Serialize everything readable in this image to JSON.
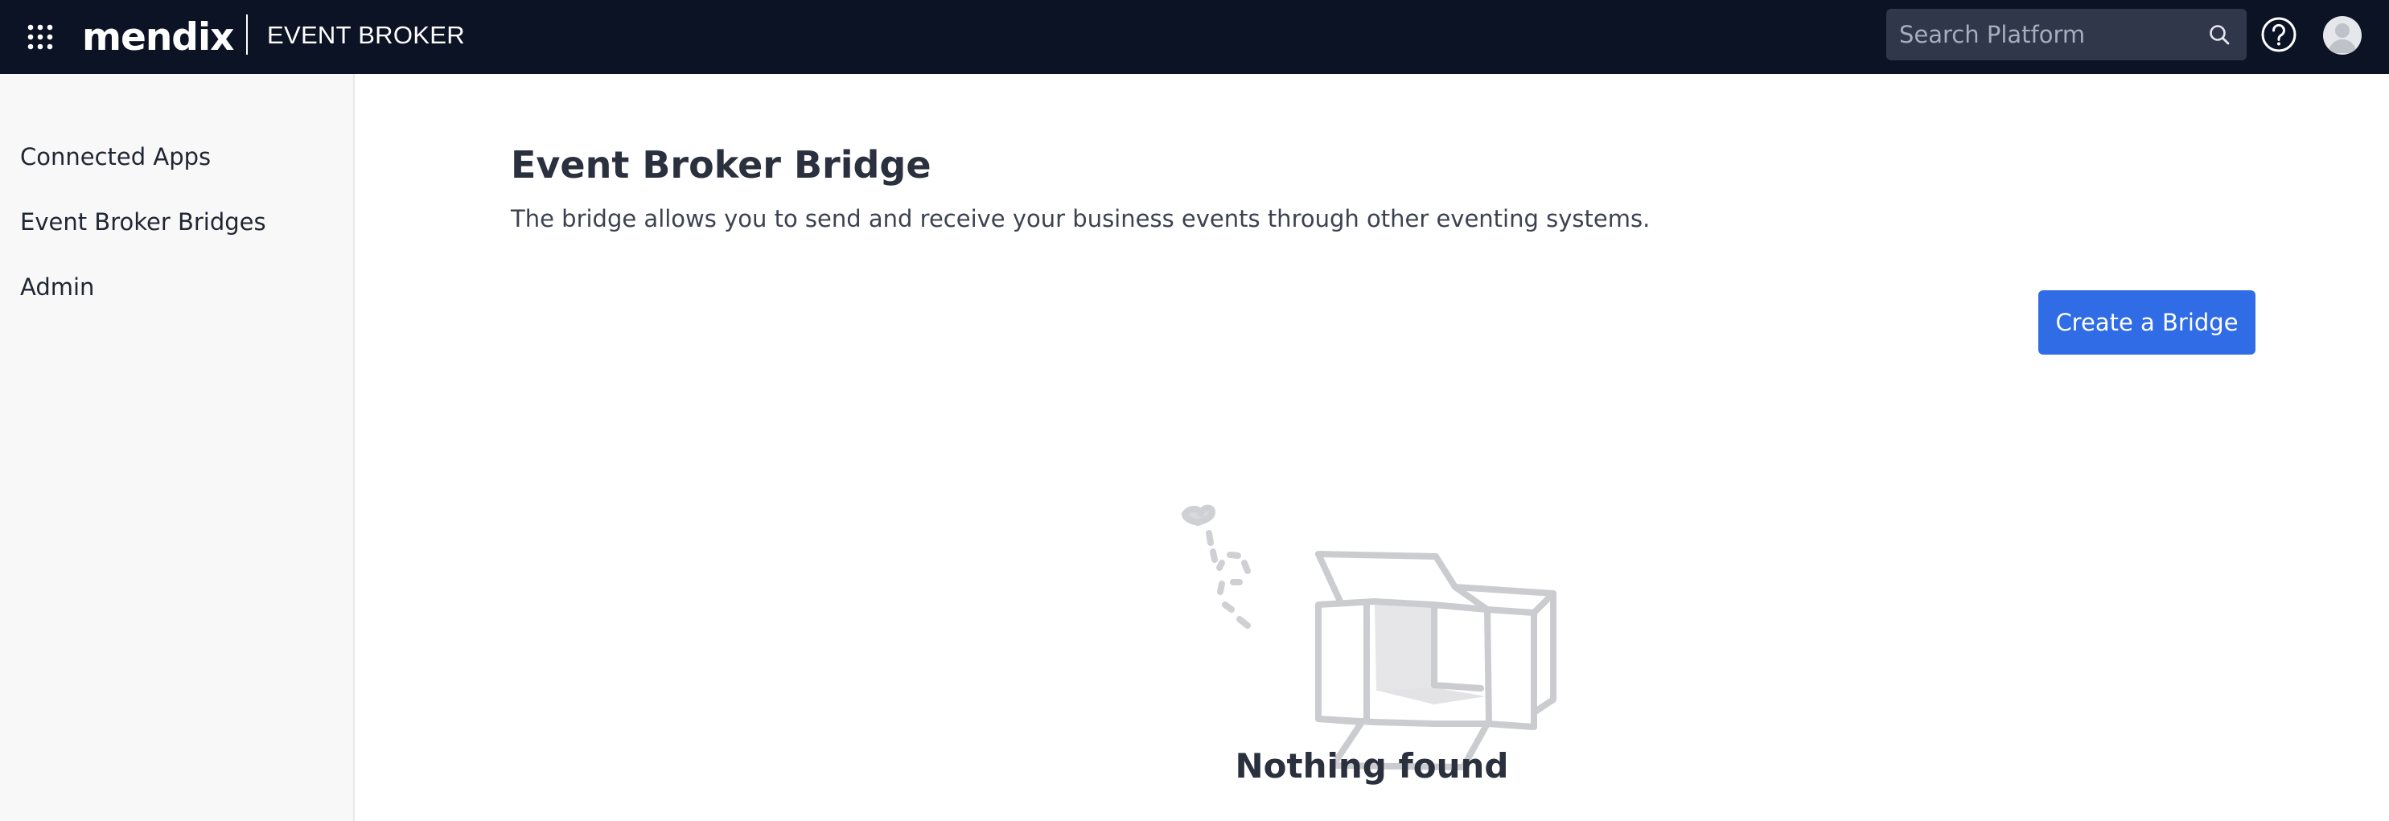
{
  "header": {
    "logo_text": "mendix",
    "product_name": "EVENT BROKER",
    "search_placeholder": "Search Platform",
    "icons": [
      "apps-grid-icon",
      "search-icon",
      "help-icon",
      "user-avatar"
    ]
  },
  "sidebar": {
    "items": [
      {
        "label": "Connected Apps"
      },
      {
        "label": "Event Broker Bridges"
      },
      {
        "label": "Admin"
      }
    ]
  },
  "main": {
    "title": "Event Broker Bridge",
    "description": "The bridge allows you to send and receive your business events through other eventing systems.",
    "create_button_label": "Create a Bridge",
    "empty_state": {
      "illustration": "open-empty-box-icon",
      "title": "Nothing found"
    }
  },
  "colors": {
    "topbar_bg": "#0c1325",
    "primary_button": "#2f6ce5",
    "sidebar_bg": "#f8f8f8"
  }
}
